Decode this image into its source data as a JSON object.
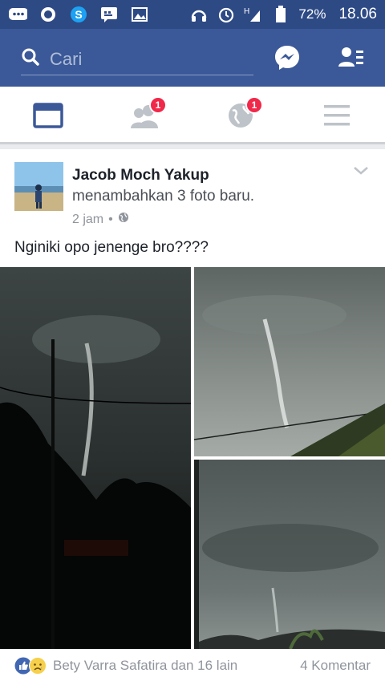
{
  "status_bar": {
    "battery": "72%",
    "time": "18.06",
    "network": "H"
  },
  "search": {
    "placeholder": "Cari"
  },
  "tabs": [
    {
      "name": "news-feed",
      "badge": ""
    },
    {
      "name": "friend-requests",
      "badge": "1"
    },
    {
      "name": "notifications",
      "badge": "1"
    },
    {
      "name": "menu",
      "badge": ""
    }
  ],
  "post": {
    "author": "Jacob Moch Yakup",
    "action": "menambahkan 3 foto baru.",
    "time": "2 jam",
    "privacy_icon": "globe-icon",
    "caption": "Nginiki opo jenenge bro????",
    "reactions_text": "Bety Varra Safatira dan 16 lain",
    "comments_text": "4 Komentar"
  },
  "colors": {
    "status_bar": "#2d4a85",
    "app_bar": "#3b5998",
    "badge": "#f02849",
    "like_blue": "#4267b2"
  }
}
